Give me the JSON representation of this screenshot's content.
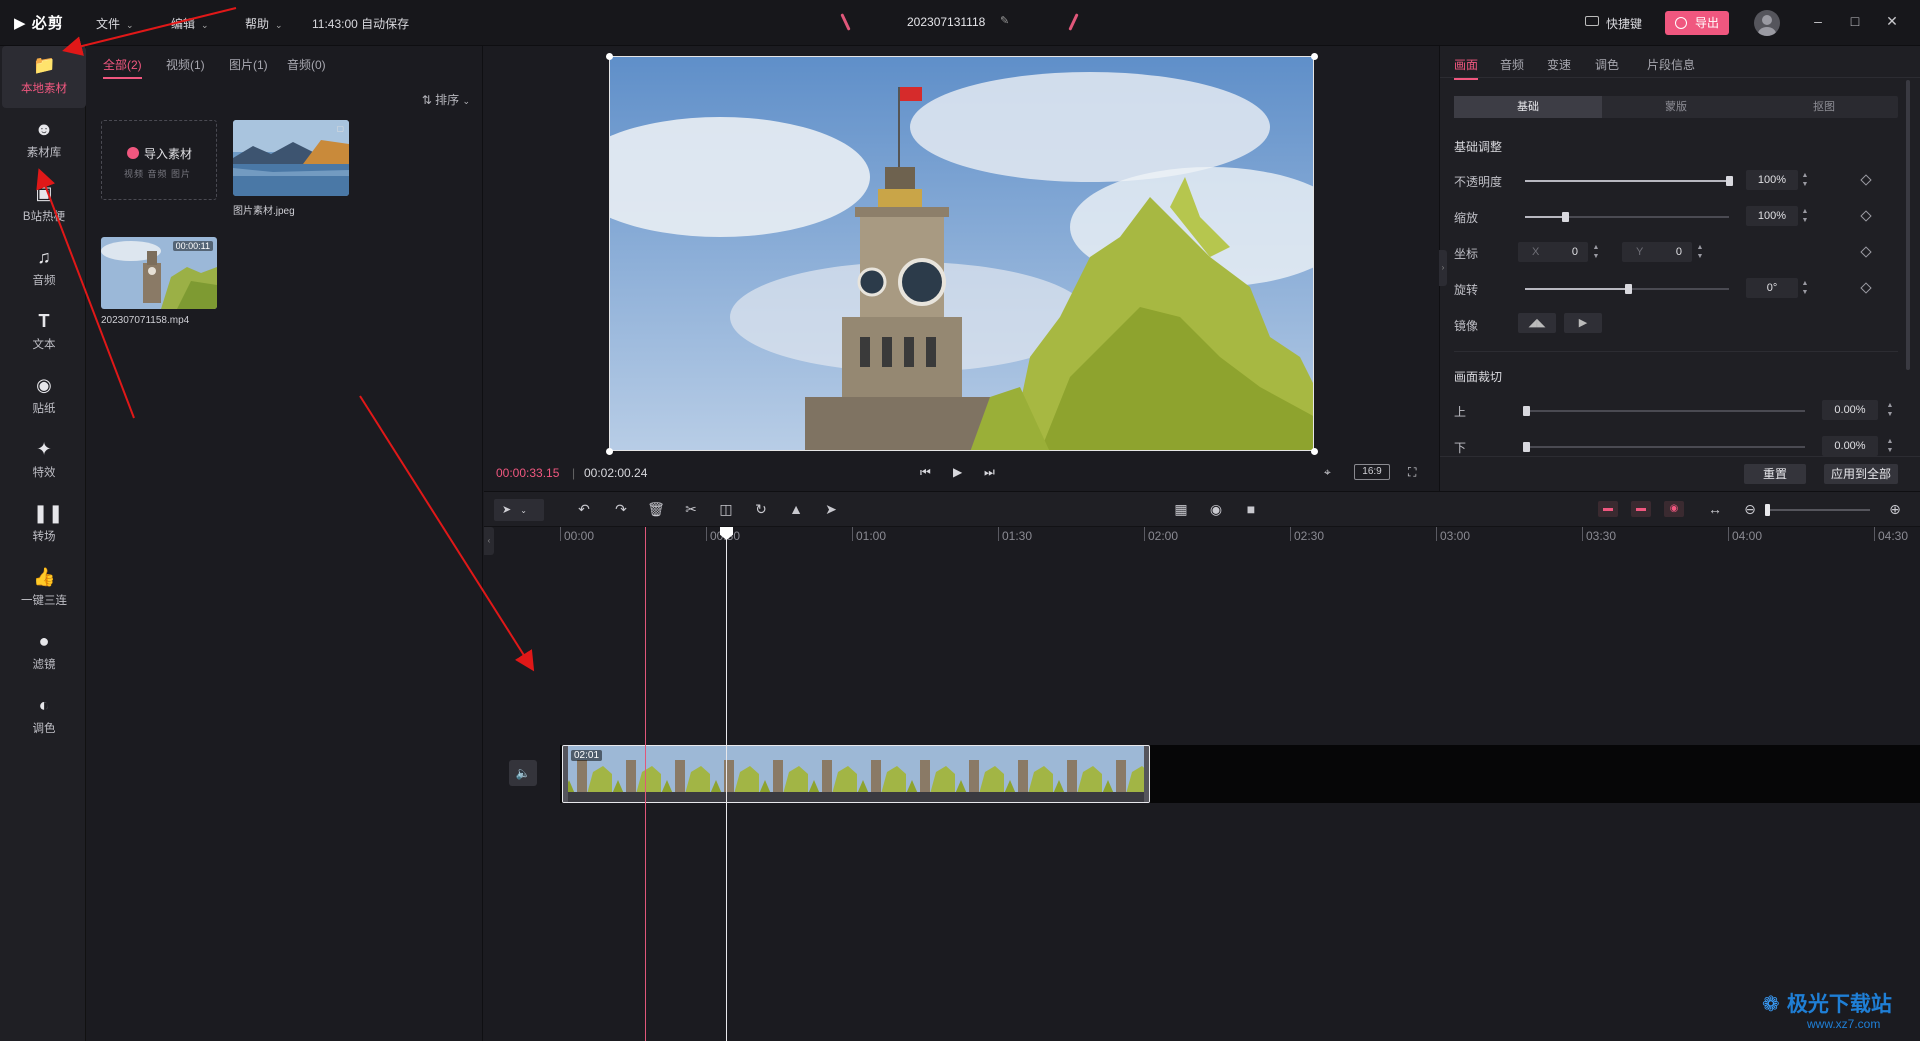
{
  "app": {
    "logo": "必剪"
  },
  "menu": [
    {
      "label": "文件"
    },
    {
      "label": "编辑"
    },
    {
      "label": "帮助"
    }
  ],
  "autosave": "11:43:00 自动保存",
  "project_title": "202307131118",
  "header": {
    "hotkey": "快捷键",
    "export": "导出"
  },
  "rail": [
    {
      "label": "本地素材",
      "icon": "folder-icon"
    },
    {
      "label": "素材库",
      "icon": "smiley-icon"
    },
    {
      "label": "B站热梗",
      "icon": "tv-icon"
    },
    {
      "label": "音频",
      "icon": "music-note-icon"
    },
    {
      "label": "文本",
      "icon": "text-icon"
    },
    {
      "label": "贴纸",
      "icon": "sticker-icon"
    },
    {
      "label": "特效",
      "icon": "star-icon"
    },
    {
      "label": "转场",
      "icon": "transition-icon"
    },
    {
      "label": "一键三连",
      "icon": "thumbs-up-icon"
    },
    {
      "label": "滤镜",
      "icon": "filter-icon"
    },
    {
      "label": "调色",
      "icon": "palette-icon"
    }
  ],
  "media": {
    "tabs": [
      "全部(2)",
      "视频(1)",
      "图片(1)",
      "音频(0)"
    ],
    "sort": "排序",
    "import_label": "导入素材",
    "import_sub": "视频 音频 图片",
    "items": [
      {
        "name": "图片素材.jpeg"
      },
      {
        "name": "202307071158.mp4",
        "duration": "00:00:11"
      }
    ]
  },
  "preview": {
    "current_time": "00:00:33.15",
    "total_time": "00:02:00.24",
    "ratio": "16:9"
  },
  "props": {
    "tabs": [
      "画面",
      "音频",
      "变速",
      "调色",
      "片段信息"
    ],
    "segments": [
      "基础",
      "蒙版",
      "抠图"
    ],
    "basic_title": "基础调整",
    "opacity_label": "不透明度",
    "opacity_value": "100%",
    "scale_label": "缩放",
    "scale_value": "100%",
    "position_label": "坐标",
    "pos_x_key": "X",
    "pos_x": "0",
    "pos_y_key": "Y",
    "pos_y": "0",
    "rotate_label": "旋转",
    "rotate_value": "0°",
    "mirror_label": "镜像",
    "crop_title": "画面裁切",
    "crop_top_label": "上",
    "crop_top_value": "0.00%",
    "crop_bottom_label": "下",
    "crop_bottom_value": "0.00%",
    "reset": "重置",
    "apply_all": "应用到全部"
  },
  "timeline": {
    "ticks": [
      "00:00",
      "00:30",
      "01:00",
      "01:30",
      "02:00",
      "02:30",
      "03:00",
      "03:30",
      "04:00",
      "04:30"
    ],
    "clip_duration": "02:01"
  },
  "watermark": {
    "title": "极光下载站",
    "url": "www.xz7.com"
  },
  "colors": {
    "accent": "#f0577f",
    "bg": "#1b1b20",
    "panel": "#1f1f24"
  }
}
